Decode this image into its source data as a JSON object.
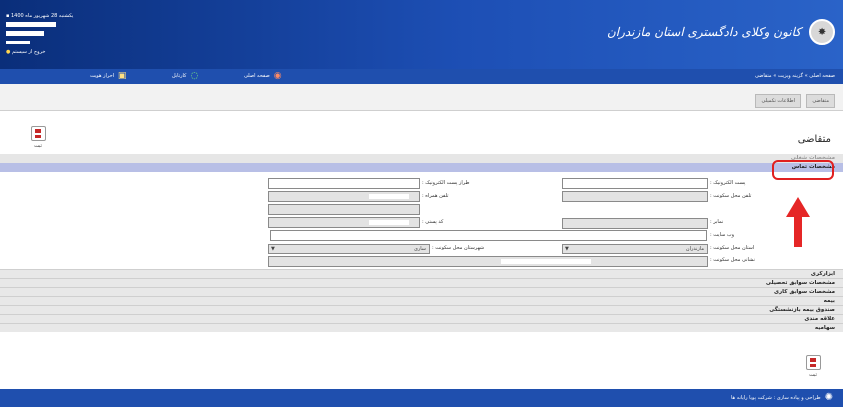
{
  "header": {
    "brand_title": "کانون وکلای دادگستری استان مازندران",
    "user_date": "یکشنبه 28 شهریور ماه 1400",
    "logout_label": "خروج از سیستم"
  },
  "menubar": {
    "breadcrumb": "صفحه اصلی » گزینه ویزیت » متقاضی",
    "home_label": "صفحه اصلی",
    "cartable_label": "کارتابل",
    "identity_label": "احراز هویت"
  },
  "tabs": [
    {
      "label": "متقاضی"
    },
    {
      "label": "اطلاعات تکمیلی"
    }
  ],
  "toolbar": {
    "save_label": "ثبت"
  },
  "page": {
    "title": "متقاضی"
  },
  "sections": {
    "job_info": "مشخصات شغلی",
    "contact_info": "مشخصات تماس"
  },
  "form": {
    "email_label": "پست الکترونیک :",
    "alt_email_label": "طراز پست الکترونیک :",
    "home_phone_label": "تلفن محل سکونت :",
    "mobile_label": "تلفن همراه :",
    "fax_label": "نمابر :",
    "postal_code_label": "کد پستی :",
    "website_label": "وب سایت :",
    "province_label": "استان محل سکونت :",
    "province_value": "مازندران",
    "city_label": "شهرستان محل سکونت :",
    "city_value": "ساری",
    "address_label": "نشانی محل سکونت :"
  },
  "accordion": [
    {
      "label": "ابزارکری"
    },
    {
      "label": "مشخصات سوابق تحصیلی"
    },
    {
      "label": "مشخصات سوابق کاری"
    },
    {
      "label": "بیمه"
    },
    {
      "label": "صندوق بیمه بازنشستگی"
    },
    {
      "label": "علاقه مندی"
    },
    {
      "label": "سهامیه"
    }
  ],
  "footer": {
    "credit": "طراحی و پیاده سازی : شرکت پویا رایانه ها"
  },
  "colors": {
    "header": "#1d4fb5",
    "menubar": "#1f4fae",
    "contact_section": "#b8bfe6",
    "highlight": "#e02020"
  }
}
